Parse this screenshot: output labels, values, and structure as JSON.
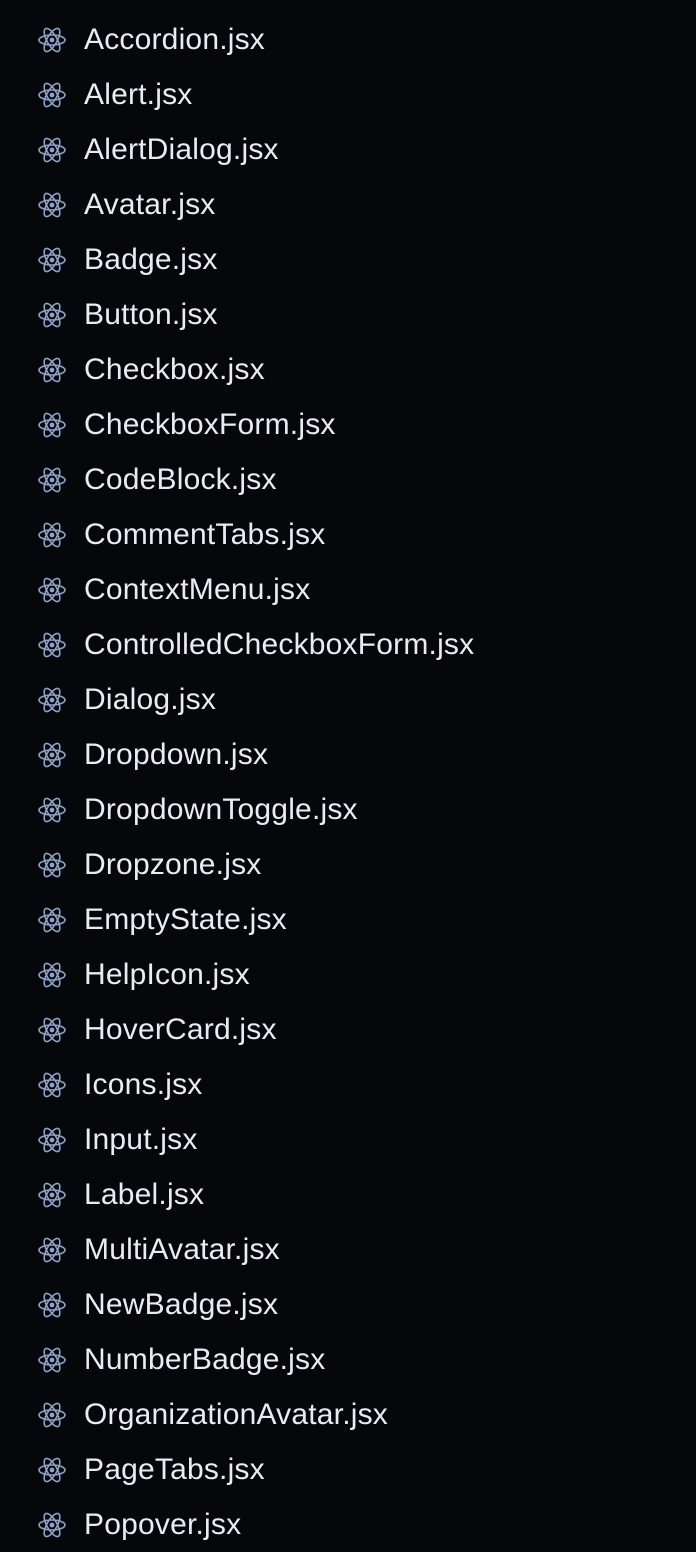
{
  "explorer": {
    "icon": "react-icon",
    "icon_color": "#8fa3c8",
    "text_color": "#e6edf3",
    "background": "#05070b",
    "files": [
      {
        "label": "Accordion.jsx"
      },
      {
        "label": "Alert.jsx"
      },
      {
        "label": "AlertDialog.jsx"
      },
      {
        "label": "Avatar.jsx"
      },
      {
        "label": "Badge.jsx"
      },
      {
        "label": "Button.jsx"
      },
      {
        "label": "Checkbox.jsx"
      },
      {
        "label": "CheckboxForm.jsx"
      },
      {
        "label": "CodeBlock.jsx"
      },
      {
        "label": "CommentTabs.jsx"
      },
      {
        "label": "ContextMenu.jsx"
      },
      {
        "label": "ControlledCheckboxForm.jsx"
      },
      {
        "label": "Dialog.jsx"
      },
      {
        "label": "Dropdown.jsx"
      },
      {
        "label": "DropdownToggle.jsx"
      },
      {
        "label": "Dropzone.jsx"
      },
      {
        "label": "EmptyState.jsx"
      },
      {
        "label": "HelpIcon.jsx"
      },
      {
        "label": "HoverCard.jsx"
      },
      {
        "label": "Icons.jsx"
      },
      {
        "label": "Input.jsx"
      },
      {
        "label": "Label.jsx"
      },
      {
        "label": "MultiAvatar.jsx"
      },
      {
        "label": "NewBadge.jsx"
      },
      {
        "label": "NumberBadge.jsx"
      },
      {
        "label": "OrganizationAvatar.jsx"
      },
      {
        "label": "PageTabs.jsx"
      },
      {
        "label": "Popover.jsx"
      }
    ]
  }
}
